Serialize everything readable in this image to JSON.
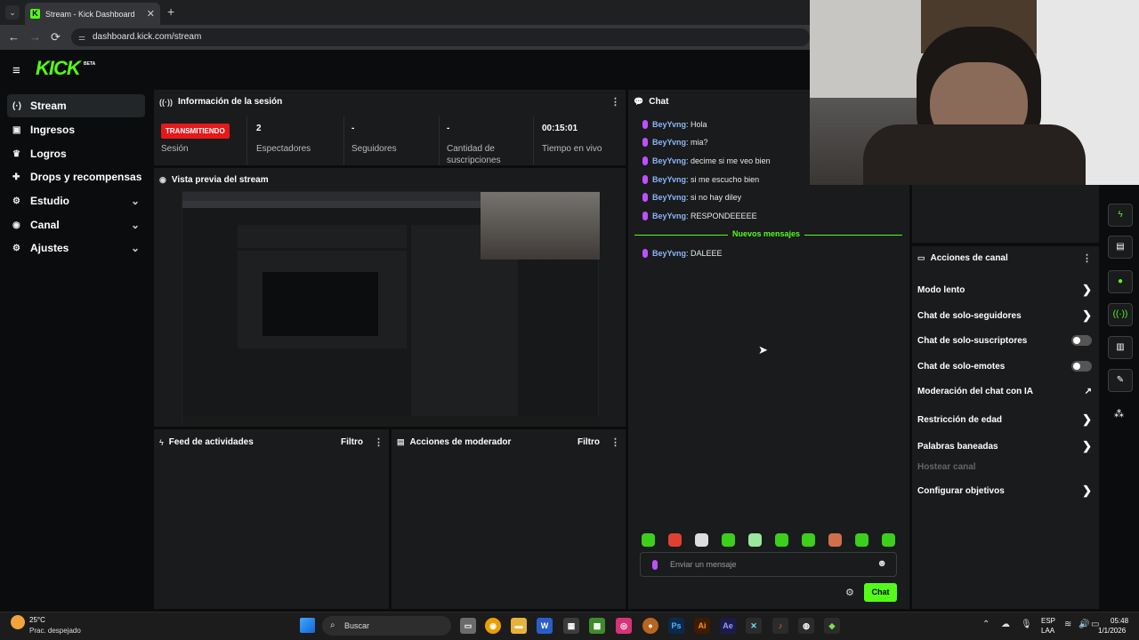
{
  "browser": {
    "tab_title": "Stream - Kick Dashboard",
    "tab_close": "✕",
    "new_tab": "+",
    "url": "dashboard.kick.com/stream",
    "back": "←",
    "forward": "→",
    "reload": "⟳",
    "tab_list": "⌄"
  },
  "app": {
    "logo": "KICK",
    "logo_badge": "BETA",
    "menu_icon": "≡"
  },
  "sidebar": {
    "items": [
      {
        "label": "Stream",
        "icon": "(·)"
      },
      {
        "label": "Ingresos",
        "icon": "▣"
      },
      {
        "label": "Logros",
        "icon": "♛"
      },
      {
        "label": "Drops y recompensas",
        "icon": "✚"
      },
      {
        "label": "Estudio",
        "icon": "⚙"
      },
      {
        "label": "Canal",
        "icon": "◉"
      },
      {
        "label": "Ajustes",
        "icon": "⚙"
      }
    ],
    "chevron": "⌄"
  },
  "session": {
    "title": "Información de la sesión",
    "badge": "TRANSMITIENDO",
    "badge_label": "Sesión",
    "stats": [
      {
        "value": "2",
        "label": "Espectadores"
      },
      {
        "value": "-",
        "label": "Seguidores"
      },
      {
        "value": "-",
        "label": "Cantidad de suscripciones"
      },
      {
        "value": "00:15:01",
        "label": "Tiempo en vivo"
      }
    ]
  },
  "preview": {
    "title": "Vista previa del stream"
  },
  "activity": {
    "title": "Feed de actividades",
    "filter": "Filtro"
  },
  "modactions": {
    "title": "Acciones de moderador",
    "filter": "Filtro"
  },
  "chat": {
    "title": "Chat",
    "messages": [
      {
        "user": "BeyYvng",
        "text": "Hola"
      },
      {
        "user": "BeyYvng",
        "text": "mia?"
      },
      {
        "user": "BeyYvng",
        "text": "decime si me veo bien"
      },
      {
        "user": "BeyYvng",
        "text": "si me escucho bien"
      },
      {
        "user": "BeyYvng",
        "text": "si no hay diley"
      },
      {
        "user": "BeyYvng",
        "text": "RESPONDEEEEE"
      }
    ],
    "new_messages": "Nuevos mensajes",
    "after_divider": [
      {
        "user": "BeyYvng",
        "text": "DALEEE"
      }
    ],
    "placeholder": "Enviar un mensaje",
    "send_label": "Chat",
    "accent": "#53fc18"
  },
  "channel_actions": {
    "title": "Acciones de canal",
    "items": [
      {
        "label": "Modo lento",
        "kind": "arrow"
      },
      {
        "label": "Chat de solo-seguidores",
        "kind": "arrow"
      },
      {
        "label": "Chat de solo-suscriptores",
        "kind": "toggle",
        "on": false
      },
      {
        "label": "Chat de solo-emotes",
        "kind": "toggle",
        "on": false
      },
      {
        "label": "Moderación del chat con IA",
        "kind": "external"
      },
      {
        "label": "Restricción de edad",
        "kind": "arrow"
      },
      {
        "label": "Palabras baneadas",
        "kind": "arrow"
      },
      {
        "label": "Hostear canal",
        "kind": "disabled"
      },
      {
        "label": "Configurar objetivos",
        "kind": "arrow"
      }
    ]
  },
  "taskbar": {
    "weather_temp": "25°C",
    "weather_desc": "Prac. despejado",
    "search": "Buscar",
    "lang1": "ESP",
    "lang2": "LAA",
    "time": "05:48",
    "date": "1/1/2026"
  }
}
